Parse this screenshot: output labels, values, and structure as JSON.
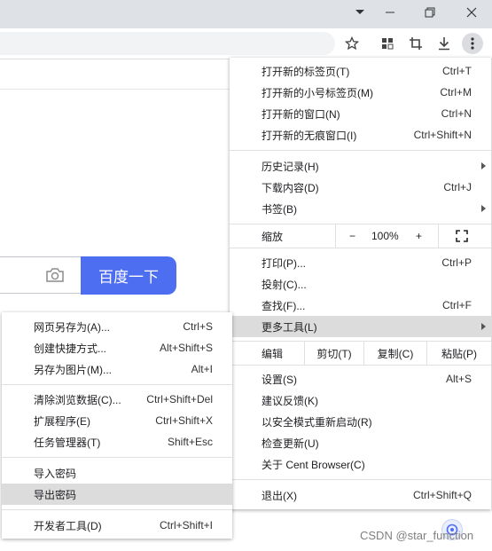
{
  "titlebar": {
    "controls": [
      "chevron-down",
      "minimize",
      "restore",
      "close"
    ]
  },
  "page": {
    "search_button": "百度一下"
  },
  "chrome_menu": {
    "group1": [
      {
        "label": "打开新的标签页(T)",
        "shortcut": "Ctrl+T"
      },
      {
        "label": "打开新的小号标签页(M)",
        "shortcut": "Ctrl+M"
      },
      {
        "label": "打开新的窗口(N)",
        "shortcut": "Ctrl+N"
      },
      {
        "label": "打开新的无痕窗口(I)",
        "shortcut": "Ctrl+Shift+N"
      }
    ],
    "group2": [
      {
        "label": "历史记录(H)",
        "submenu": true
      },
      {
        "label": "下载内容(D)",
        "shortcut": "Ctrl+J"
      },
      {
        "label": "书签(B)",
        "submenu": true
      }
    ],
    "zoom": {
      "label": "缩放",
      "minus": "−",
      "value": "100%",
      "plus": "+"
    },
    "group3": [
      {
        "label": "打印(P)...",
        "shortcut": "Ctrl+P"
      },
      {
        "label": "投射(C)..."
      },
      {
        "label": "查找(F)...",
        "shortcut": "Ctrl+F"
      },
      {
        "label": "更多工具(L)",
        "submenu": true,
        "highlighted": true
      }
    ],
    "edit": {
      "label": "编辑",
      "cut": "剪切(T)",
      "copy": "复制(C)",
      "paste": "粘贴(P)"
    },
    "group4": [
      {
        "label": "设置(S)",
        "shortcut": "Alt+S"
      },
      {
        "label": "建议反馈(K)"
      },
      {
        "label": "以安全模式重新启动(R)"
      },
      {
        "label": "检查更新(U)"
      },
      {
        "label": "关于 Cent Browser(C)"
      }
    ],
    "group5": [
      {
        "label": "退出(X)",
        "shortcut": "Ctrl+Shift+Q"
      }
    ]
  },
  "more_tools_menu": {
    "group1": [
      {
        "label": "网页另存为(A)...",
        "shortcut": "Ctrl+S"
      },
      {
        "label": "创建快捷方式...",
        "shortcut": "Alt+Shift+S"
      },
      {
        "label": "另存为图片(M)...",
        "shortcut": "Alt+I"
      }
    ],
    "group2": [
      {
        "label": "清除浏览数据(C)...",
        "shortcut": "Ctrl+Shift+Del"
      },
      {
        "label": "扩展程序(E)",
        "shortcut": "Ctrl+Shift+X"
      },
      {
        "label": "任务管理器(T)",
        "shortcut": "Shift+Esc"
      }
    ],
    "group3": [
      {
        "label": "导入密码"
      },
      {
        "label": "导出密码",
        "highlighted": true
      }
    ],
    "group4": [
      {
        "label": "开发者工具(D)",
        "shortcut": "Ctrl+Shift+I"
      }
    ]
  },
  "watermark": "CSDN @star_function",
  "colors": {
    "accent": "#4e6ef2",
    "highlight": "#dcdcdc"
  }
}
